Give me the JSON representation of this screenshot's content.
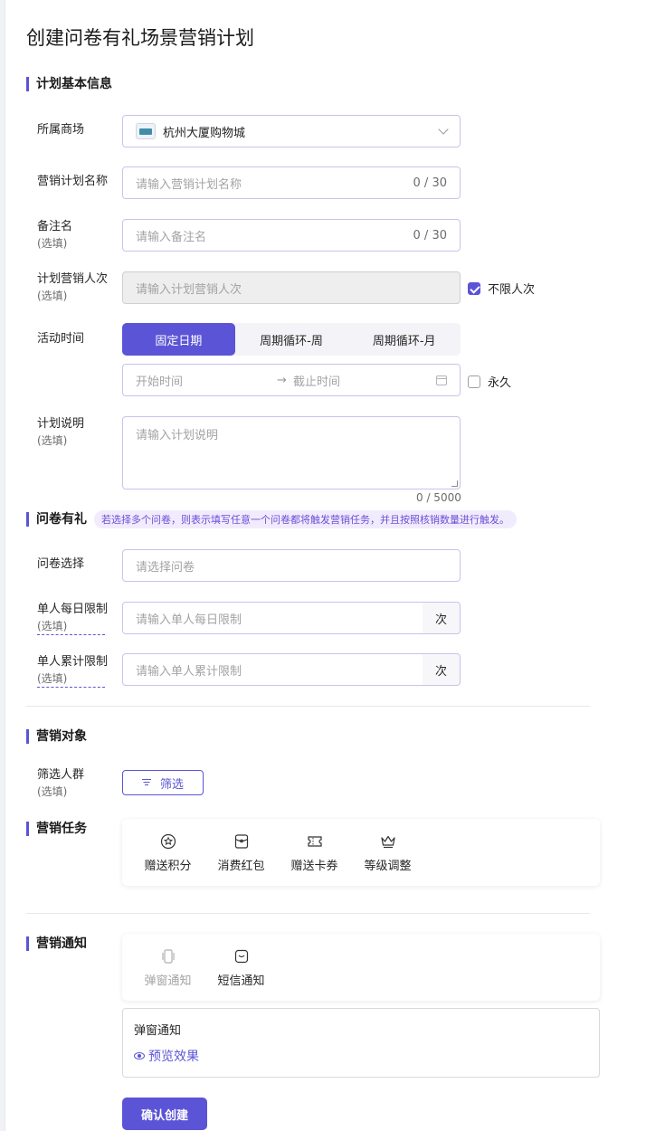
{
  "page": {
    "title": "创建问卷有礼场景营销计划"
  },
  "colors": {
    "accent": "#5b54d6",
    "tip_bg": "#f1ecfd"
  },
  "sections": {
    "basic": "计划基本信息",
    "survey": "问卷有礼",
    "target": "营销对象",
    "task": "营销任务",
    "notice": "营销通知"
  },
  "form": {
    "mall": {
      "label": "所属商场",
      "value": "杭州大厦购物城",
      "icon": "mall-logo-icon"
    },
    "plan_name": {
      "label": "营销计划名称",
      "placeholder": "请输入营销计划名称",
      "count": "0 / 30"
    },
    "remark": {
      "label": "备注名",
      "optional": "(选填)",
      "placeholder": "请输入备注名",
      "count": "0 / 30"
    },
    "people": {
      "label": "计划营销人次",
      "optional": "(选填)",
      "placeholder": "请输入计划营销人次",
      "unlimited_label": "不限人次",
      "unlimited_checked": true
    },
    "time": {
      "label": "活动时间",
      "options": [
        "固定日期",
        "周期循环-周",
        "周期循环-月"
      ],
      "selected": "固定日期",
      "start_placeholder": "开始时间",
      "arrow": "→",
      "end_placeholder": "截止时间",
      "forever_label": "永久",
      "forever_checked": false
    },
    "desc": {
      "label": "计划说明",
      "optional": "(选填)",
      "placeholder": "请输入计划说明",
      "count": "0 / 5000"
    }
  },
  "survey": {
    "tip": "若选择多个问卷，则表示填写任意一个问卷都将触发营销任务，并且按照核销数量进行触发。",
    "select": {
      "label": "问卷选择",
      "placeholder": "请选择问卷"
    },
    "daily": {
      "label": "单人每日限制",
      "optional": "(选填)",
      "placeholder": "请输入单人每日限制",
      "unit": "次"
    },
    "total": {
      "label": "单人累计限制",
      "optional": "(选填)",
      "placeholder": "请输入单人累计限制",
      "unit": "次"
    }
  },
  "target": {
    "label": "筛选人群",
    "optional": "(选填)",
    "button": "筛选"
  },
  "tasks": [
    {
      "label": "赠送积分",
      "icon": "points-icon"
    },
    {
      "label": "消费红包",
      "icon": "red-packet-icon"
    },
    {
      "label": "赠送卡券",
      "icon": "coupon-icon"
    },
    {
      "label": "等级调整",
      "icon": "crown-icon"
    }
  ],
  "notices": [
    {
      "label": "弹窗通知",
      "icon": "popup-icon",
      "muted": true
    },
    {
      "label": "短信通知",
      "icon": "sms-icon",
      "muted": false
    }
  ],
  "notice_panel": {
    "title": "弹窗通知",
    "preview": "预览效果"
  },
  "submit": "确认创建"
}
